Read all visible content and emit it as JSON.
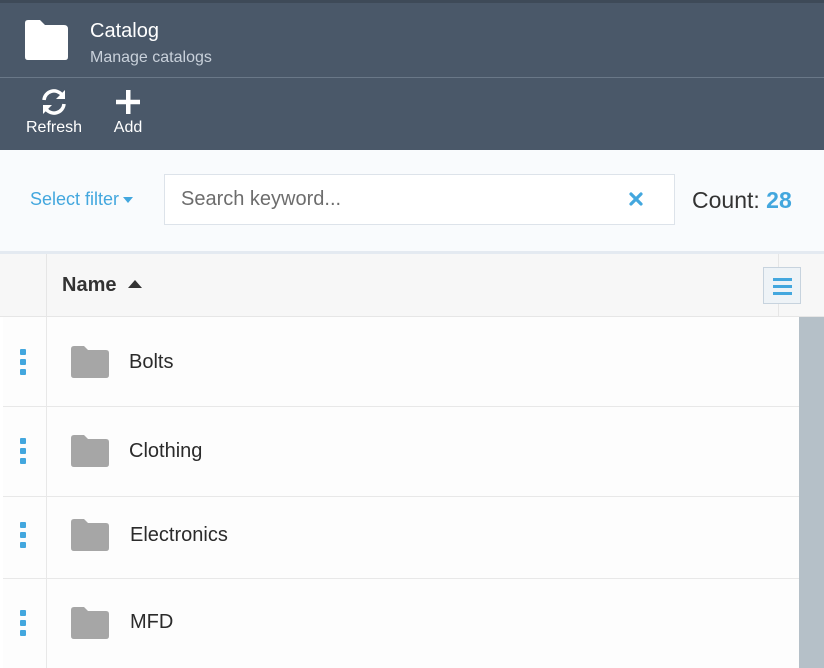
{
  "header": {
    "title": "Catalog",
    "subtitle": "Manage catalogs",
    "icon": "folder-icon"
  },
  "toolbar": {
    "refresh_label": "Refresh",
    "add_label": "Add"
  },
  "filter": {
    "select_filter_label": "Select filter",
    "search_placeholder": "Search keyword...",
    "search_value": "",
    "count_label": "Count:",
    "count_value": "28"
  },
  "grid": {
    "columns": [
      {
        "label": "Name",
        "sort": "ascending"
      }
    ],
    "rows": [
      {
        "name": "Bolts",
        "icon": "folder-icon"
      },
      {
        "name": "Clothing",
        "icon": "folder-icon"
      },
      {
        "name": "Electronics",
        "icon": "folder-icon"
      },
      {
        "name": "MFD",
        "icon": "folder-icon"
      }
    ]
  },
  "colors": {
    "header_bg": "#4a5869",
    "accent": "#43a7de",
    "folder_gray": "#a6a6a6"
  }
}
